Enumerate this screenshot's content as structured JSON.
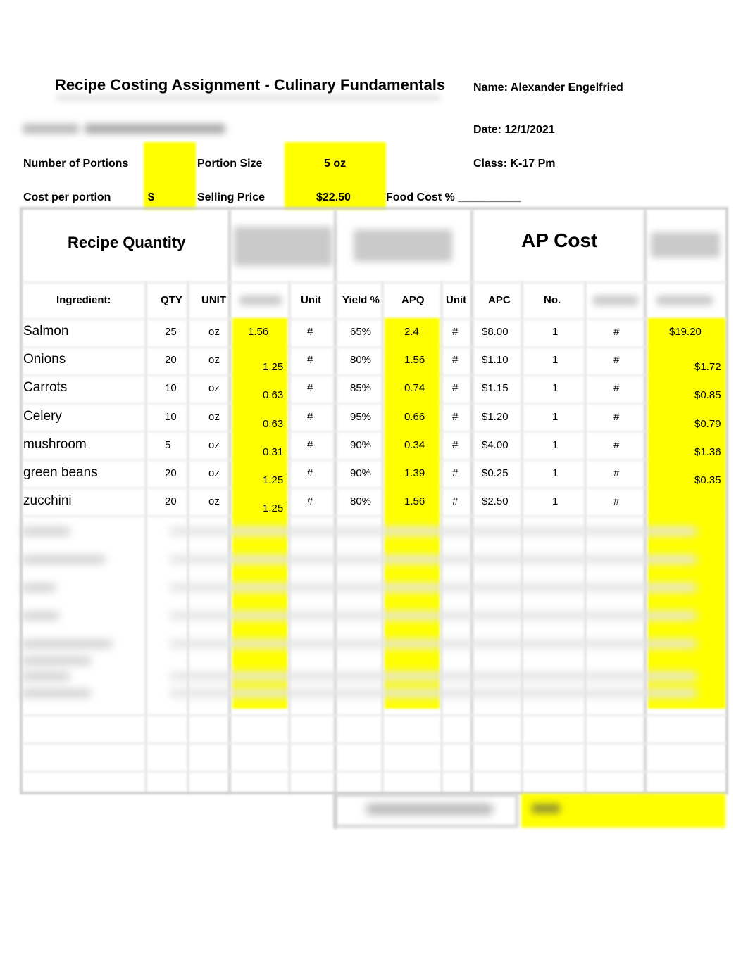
{
  "header": {
    "title": "Recipe Costing Assignment - Culinary Fundamentals",
    "name": "Name: Alexander Engelfried",
    "date": "Date: 12/1/2021",
    "class": "Class: K-17 Pm"
  },
  "form": {
    "number_of_portions_label": "Number of Portions",
    "number_of_portions_value": "",
    "portion_size_label": "Portion Size",
    "portion_size_value": "5 oz",
    "cost_per_portion_label": "Cost per portion",
    "cost_per_portion_value": "$",
    "selling_price_label": "Selling Price",
    "selling_price_value": "$22.50",
    "food_cost_label": "Food Cost % __________"
  },
  "table": {
    "section_recipe_quantity": "Recipe Quantity",
    "section_ap_cost": "AP Cost",
    "columns": [
      "Ingredient:",
      "QTY",
      "UNIT",
      "Unit",
      "Yield %",
      "APQ",
      "Unit",
      "APC",
      "No."
    ],
    "rows": [
      {
        "ingredient": "Salmon",
        "qty": "25",
        "unit": "oz",
        "conv": "1.56",
        "conv_unit": "#",
        "yield": "65%",
        "apq": "2.4",
        "apq_unit": "#",
        "apc": "$8.00",
        "no": "1",
        "no_unit": "#",
        "cost": "$19.20"
      },
      {
        "ingredient": "Onions",
        "qty": "20",
        "unit": "oz",
        "conv": "1.25",
        "conv_unit": "#",
        "yield": "80%",
        "apq": "1.56",
        "apq_unit": "#",
        "apc": "$1.10",
        "no": "1",
        "no_unit": "#",
        "cost": "$1.72"
      },
      {
        "ingredient": "Carrots",
        "qty": "10",
        "unit": "oz",
        "conv": "0.63",
        "conv_unit": "#",
        "yield": "85%",
        "apq": "0.74",
        "apq_unit": "#",
        "apc": "$1.15",
        "no": "1",
        "no_unit": "#",
        "cost": "$0.85"
      },
      {
        "ingredient": "Celery",
        "qty": "10",
        "unit": "oz",
        "conv": "0.63",
        "conv_unit": "#",
        "yield": "95%",
        "apq": "0.66",
        "apq_unit": "#",
        "apc": "$1.20",
        "no": "1",
        "no_unit": "#",
        "cost": "$0.79"
      },
      {
        "ingredient": "mushroom",
        "qty": "5",
        "unit": "oz",
        "conv": "0.31",
        "conv_unit": "#",
        "yield": "90%",
        "apq": "0.34",
        "apq_unit": "#",
        "apc": "$4.00",
        "no": "1",
        "no_unit": "#",
        "cost": "$1.36"
      },
      {
        "ingredient": "green beans",
        "qty": "20",
        "unit": "oz",
        "conv": "1.25",
        "conv_unit": "#",
        "yield": "90%",
        "apq": "1.39",
        "apq_unit": "#",
        "apc": "$0.25",
        "no": "1",
        "no_unit": "#",
        "cost": "$0.35"
      },
      {
        "ingredient": "zucchini",
        "qty": "20",
        "unit": "oz",
        "conv": "1.25",
        "conv_unit": "#",
        "yield": "80%",
        "apq": "1.56",
        "apq_unit": "#",
        "apc": "$2.50",
        "no": "1",
        "no_unit": "#",
        "cost": ""
      }
    ]
  },
  "colors": {
    "highlight": "#ffff00",
    "grid": "#d0d0d0"
  }
}
